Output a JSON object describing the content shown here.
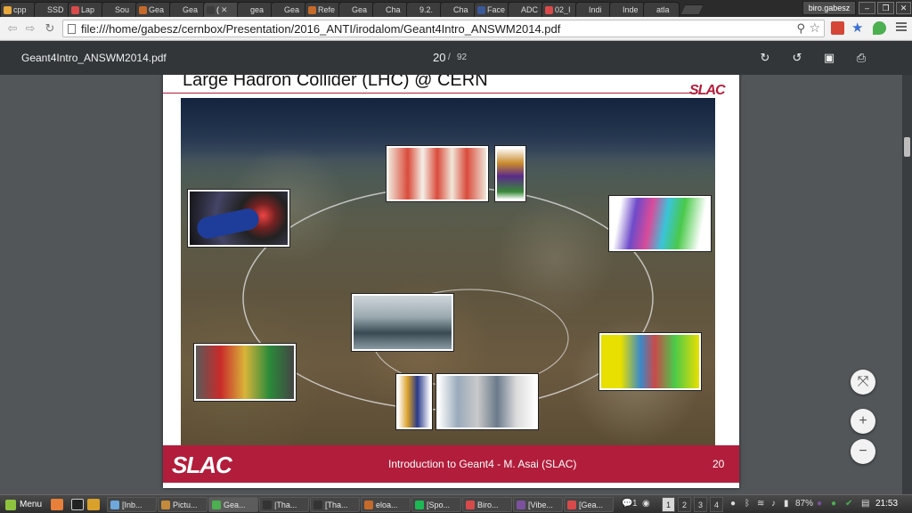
{
  "tabs": [
    {
      "label": "cpp",
      "color": "#e8a83c"
    },
    {
      "label": "SSD",
      "color": "#3d3d3d"
    },
    {
      "label": "Lap",
      "color": "#d84a4a"
    },
    {
      "label": "Sou",
      "color": "#3d3d3d"
    },
    {
      "label": "Gea",
      "color": "#c46a2a"
    },
    {
      "label": "Gea",
      "color": "#3d3d3d"
    },
    {
      "label": "(",
      "color": "#3d3d3d",
      "active": true
    },
    {
      "label": "gea",
      "color": "#3d3d3d"
    },
    {
      "label": "Gea",
      "color": "#3d3d3d"
    },
    {
      "label": "Refe",
      "color": "#c46a2a"
    },
    {
      "label": "Gea",
      "color": "#3d3d3d"
    },
    {
      "label": "Cha",
      "color": "#3d3d3d"
    },
    {
      "label": "9.2.",
      "color": "#3d3d3d"
    },
    {
      "label": "Cha",
      "color": "#3d3d3d"
    },
    {
      "label": "Face",
      "color": "#3b5998"
    },
    {
      "label": "ADC",
      "color": "#3d3d3d"
    },
    {
      "label": "02_I",
      "color": "#d84a4a"
    },
    {
      "label": "Indi",
      "color": "#3d3d3d"
    },
    {
      "label": "Inde",
      "color": "#3d3d3d"
    },
    {
      "label": "atla",
      "color": "#3d3d3d"
    }
  ],
  "profile": "biro.gabesz",
  "toolbar": {
    "url": "file:///home/gabesz/cernbox/Presentation/2016_ANTI/irodalom/Geant4Intro_ANSWM2014.pdf"
  },
  "pdf": {
    "title": "Geant4Intro_ANSWM2014.pdf",
    "page": "20",
    "sep": "/",
    "total": "92"
  },
  "slide": {
    "title": "Large Hadron Collider (LHC) @ CERN",
    "logo_top": "SLAC",
    "logo": "SLAC",
    "footer": "Introduction to Geant4 - M. Asai (SLAC)",
    "page": "20"
  },
  "taskbar": {
    "menu": "Menu",
    "tasks": [
      {
        "label": "[Inb...",
        "color": "#6fa8dc"
      },
      {
        "label": "Pictu...",
        "color": "#c48a3c"
      },
      {
        "label": "Gea...",
        "color": "#4caf50",
        "active": true
      },
      {
        "label": "|Tha...",
        "color": "#333"
      },
      {
        "label": "[Tha...",
        "color": "#333"
      },
      {
        "label": "eloa...",
        "color": "#c46a2a"
      },
      {
        "label": "[Spo...",
        "color": "#1db954"
      },
      {
        "label": "Biro...",
        "color": "#d84a4a"
      },
      {
        "label": "[Vibe...",
        "color": "#7b519d"
      },
      {
        "label": "[Gea...",
        "color": "#d84a4a"
      }
    ],
    "notif_count": "1",
    "workspaces": [
      "1",
      "2",
      "3",
      "4"
    ],
    "battery": "87%",
    "clock": "21:53"
  }
}
